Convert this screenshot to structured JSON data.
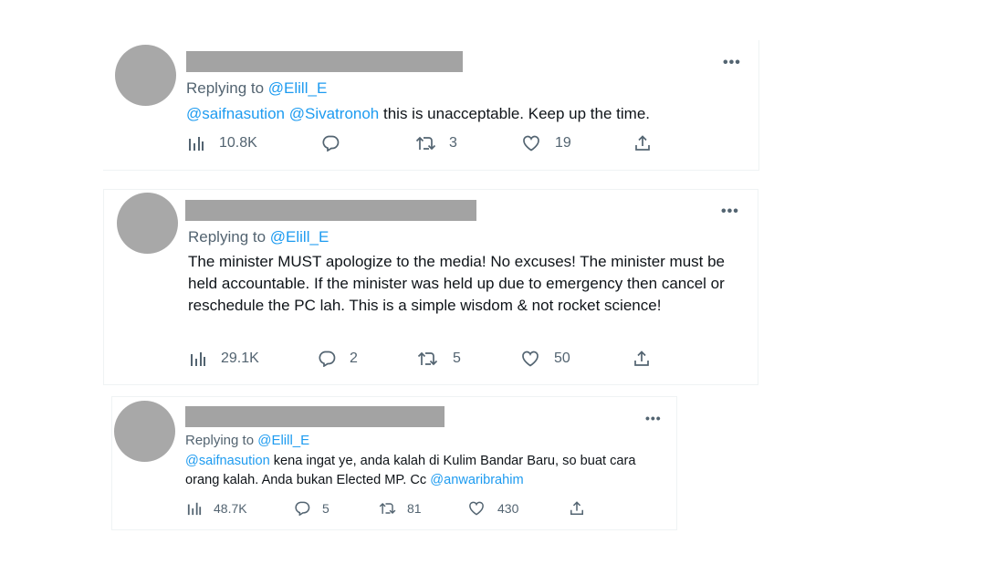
{
  "tweets": [
    {
      "replying_prefix": "Replying to ",
      "replying_handle": "@Elill_E",
      "body_mentions": [
        "@saifnasution",
        "@Sivatronoh"
      ],
      "body_text": " this is unacceptable. Keep up the time.",
      "views": "10.8K",
      "replies": "",
      "retweets": "3",
      "likes": "19"
    },
    {
      "replying_prefix": "Replying to ",
      "replying_handle": "@Elill_E",
      "body_text": "The minister MUST apologize to the media! No excuses! The minister must be held accountable. If the minister was held up due to emergency then cancel or reschedule the PC lah. This is a simple wisdom & not rocket science!",
      "views": "29.1K",
      "replies": "2",
      "retweets": "5",
      "likes": "50"
    },
    {
      "replying_prefix": "Replying to ",
      "replying_handle": "@Elill_E",
      "body_mention_start": "@saifnasution",
      "body_text": " kena ingat ye, anda kalah di Kulim Bandar Baru, so buat cara orang kalah. Anda bukan Elected MP. Cc ",
      "body_mention_end": "@anwaribrahim",
      "views": "48.7K",
      "replies": "5",
      "retweets": "81",
      "likes": "430"
    }
  ],
  "icons": {
    "views": "bar-chart-icon",
    "reply": "speech-bubble-icon",
    "retweet": "retweet-icon",
    "like": "heart-icon",
    "share": "share-icon",
    "more": "more-dots-icon"
  },
  "colors": {
    "accent": "#1d9bf0",
    "secondary": "#536471",
    "redaction": "#a3a3a3",
    "avatar": "#a8a8a8"
  }
}
